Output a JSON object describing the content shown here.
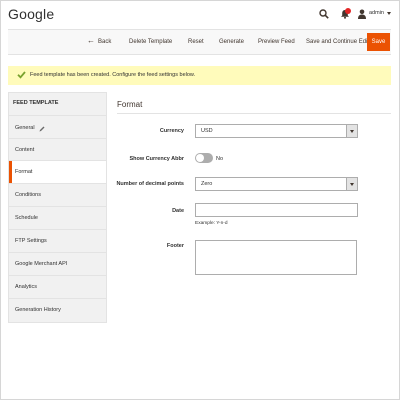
{
  "header": {
    "title": "Google",
    "user": "admin",
    "icons": [
      "search-icon",
      "bell-icon",
      "user-icon"
    ]
  },
  "toolbar": {
    "back": "Back",
    "delete": "Delete Template",
    "reset": "Reset",
    "generate": "Generate",
    "preview": "Preview Feed",
    "save_continue": "Save and Continue Edit",
    "save": "Save"
  },
  "message": {
    "text": "Feed template has been created. Configure the feed settings below."
  },
  "sidebar": {
    "title": "FEED TEMPLATE",
    "items": [
      {
        "label": "General"
      },
      {
        "label": "Content"
      },
      {
        "label": "Format"
      },
      {
        "label": "Conditions"
      },
      {
        "label": "Schedule"
      },
      {
        "label": "FTP Settings"
      },
      {
        "label": "Google Merchant API"
      },
      {
        "label": "Analytics"
      },
      {
        "label": "Generation History"
      }
    ]
  },
  "form": {
    "section_title": "Format",
    "currency": {
      "label": "Currency",
      "value": "USD"
    },
    "show_currency_abbr": {
      "label": "Show Currency Abbr",
      "value": "No"
    },
    "decimal_points": {
      "label": "Number of decimal points",
      "value": "Zero"
    },
    "date": {
      "label": "Date",
      "value": "",
      "note": "Example: Y-n-d"
    },
    "footer": {
      "label": "Footer",
      "value": ""
    }
  },
  "colors": {
    "accent": "#eb5202",
    "message_bg": "#fffbbb",
    "success_check": "#79a22e"
  }
}
